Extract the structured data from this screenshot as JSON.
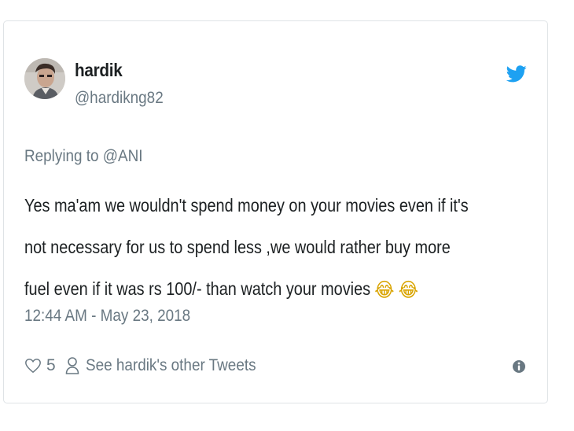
{
  "tweet": {
    "author": {
      "display_name": "hardik",
      "handle": "@hardikng82",
      "avatar_icon": "user-avatar-photo"
    },
    "brand_icon": "twitter-bird-icon",
    "brand_color": "#1da1f2",
    "reply_context": "Replying to @ANI",
    "text_lines": [
      "Yes ma'am we wouldn't spend money on your movies even if it's",
      "not necessary for us to spend less ,we would rather buy more",
      "fuel even if it was rs 100/- than watch your movies"
    ],
    "emojis": [
      "😂",
      "😂"
    ],
    "timestamp": "12:44 AM - May 23, 2018",
    "likes": "5",
    "other_tweets_label": "See hardik's other Tweets",
    "icons": {
      "like": "heart-icon",
      "profile": "person-icon",
      "info": "info-icon"
    },
    "colors": {
      "text": "#1c2022",
      "muted": "#697882",
      "border": "#dfe3e6"
    }
  }
}
